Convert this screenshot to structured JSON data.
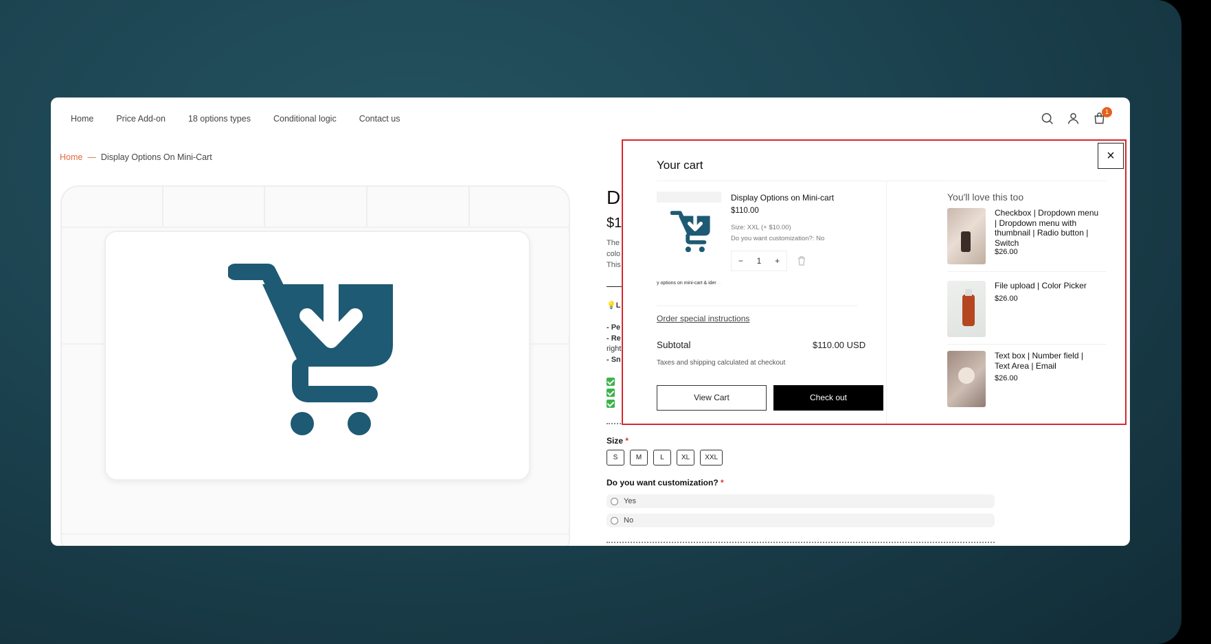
{
  "nav": {
    "items": [
      "Home",
      "Price Add-on",
      "18 options types",
      "Conditional logic",
      "Contact us"
    ],
    "cart_count": "1"
  },
  "breadcrumb": {
    "home": "Home",
    "current": "Display Options On Mini-Cart"
  },
  "product": {
    "title_fragment": "Di",
    "price_fragment": "$1",
    "desc_lines": [
      "The",
      "colo",
      "This"
    ],
    "feature_fragment": "L",
    "bullet_lines": [
      "- Pe",
      "- Re",
      "right",
      "- Sn"
    ],
    "size_label": "Size",
    "sizes": [
      "S",
      "M",
      "L",
      "XL",
      "XXL"
    ],
    "custom_label": "Do you want customization?",
    "required_mark": "*",
    "options": [
      "Yes",
      "No"
    ]
  },
  "cart": {
    "title": "Your cart",
    "close": "×",
    "thumb_caption": "y options on mini-cart & ider",
    "item": {
      "name": "Display Options on Mini-cart",
      "price": "$110.00",
      "size": "Size: XXL (+ $10.00)",
      "custom": "Do you want customization?: No",
      "qty": "1",
      "minus": "−",
      "plus": "+"
    },
    "order_instructions": "Order special instructions",
    "subtotal_label": "Subtotal",
    "subtotal_value": "$110.00 USD",
    "taxes": "Taxes and shipping calculated at checkout",
    "view_cart": "View Cart",
    "checkout": "Check out",
    "rec_title": "You'll love this too",
    "recs": [
      {
        "name": "Checkbox | Dropdown menu | Dropdown menu with thumbnail | Radio button | Switch",
        "price": "$26.00"
      },
      {
        "name": "File upload | Color Picker",
        "price": "$26.00"
      },
      {
        "name": "Text box | Number field | Text Area | Email",
        "price": "$26.00"
      }
    ]
  },
  "colors": {
    "accent": "#e2693c",
    "cart_blue": "#1e5a73",
    "highlight": "#d7262b",
    "check_green": "#3bb44a"
  }
}
